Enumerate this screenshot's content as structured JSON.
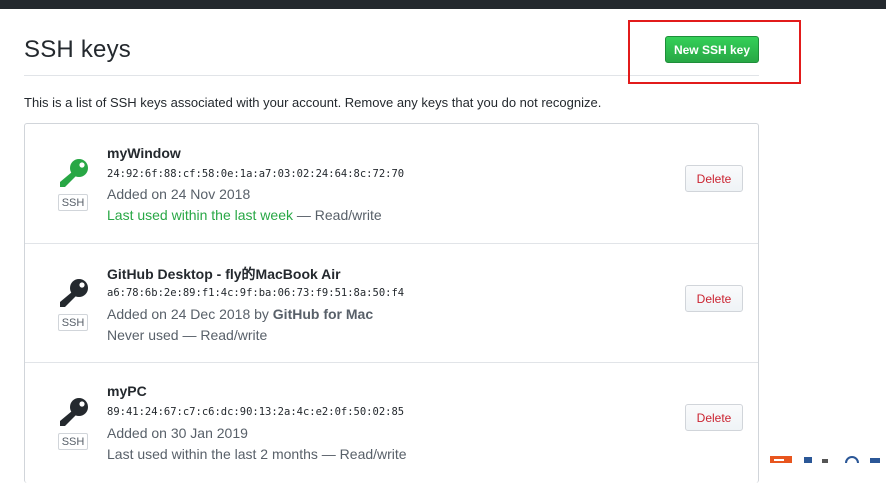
{
  "header": {
    "title": "SSH keys",
    "new_button_label": "New SSH key",
    "intro": "This is a list of SSH keys associated with your account. Remove any keys that you do not recognize."
  },
  "colors": {
    "primary_button": "#28a745",
    "danger_text": "#cb2431",
    "recent_key_icon": "#28a745",
    "old_key_icon": "#24292e",
    "highlight_box": "#e21b1b"
  },
  "keys": [
    {
      "icon": "key-icon",
      "icon_color": "green",
      "badge": "SSH",
      "name": "myWindow",
      "fingerprint": "24:92:6f:88:cf:58:0e:1a:a7:03:02:24:64:8c:72:70",
      "added_prefix": "Added on 24 Nov 2018",
      "added_by": "",
      "usage_recent": "Last used within the last week",
      "usage_suffix": " — Read/write",
      "delete_label": "Delete"
    },
    {
      "icon": "key-icon",
      "icon_color": "black",
      "badge": "SSH",
      "name": "GitHub Desktop - fly的MacBook Air",
      "fingerprint": "a6:78:6b:2e:89:f1:4c:9f:ba:06:73:f9:51:8a:50:f4",
      "added_prefix": "Added on 24 Dec 2018 by ",
      "added_by": "GitHub for Mac",
      "usage_text": "Never used — Read/write",
      "delete_label": "Delete"
    },
    {
      "icon": "key-icon",
      "icon_color": "black",
      "badge": "SSH",
      "name": "myPC",
      "fingerprint": "89:41:24:67:c7:c6:dc:90:13:2a:4c:e2:0f:50:02:85",
      "added_prefix": "Added on 30 Jan 2019",
      "added_by": "",
      "usage_text": "Last used within the last 2 months — Read/write",
      "delete_label": "Delete"
    }
  ]
}
